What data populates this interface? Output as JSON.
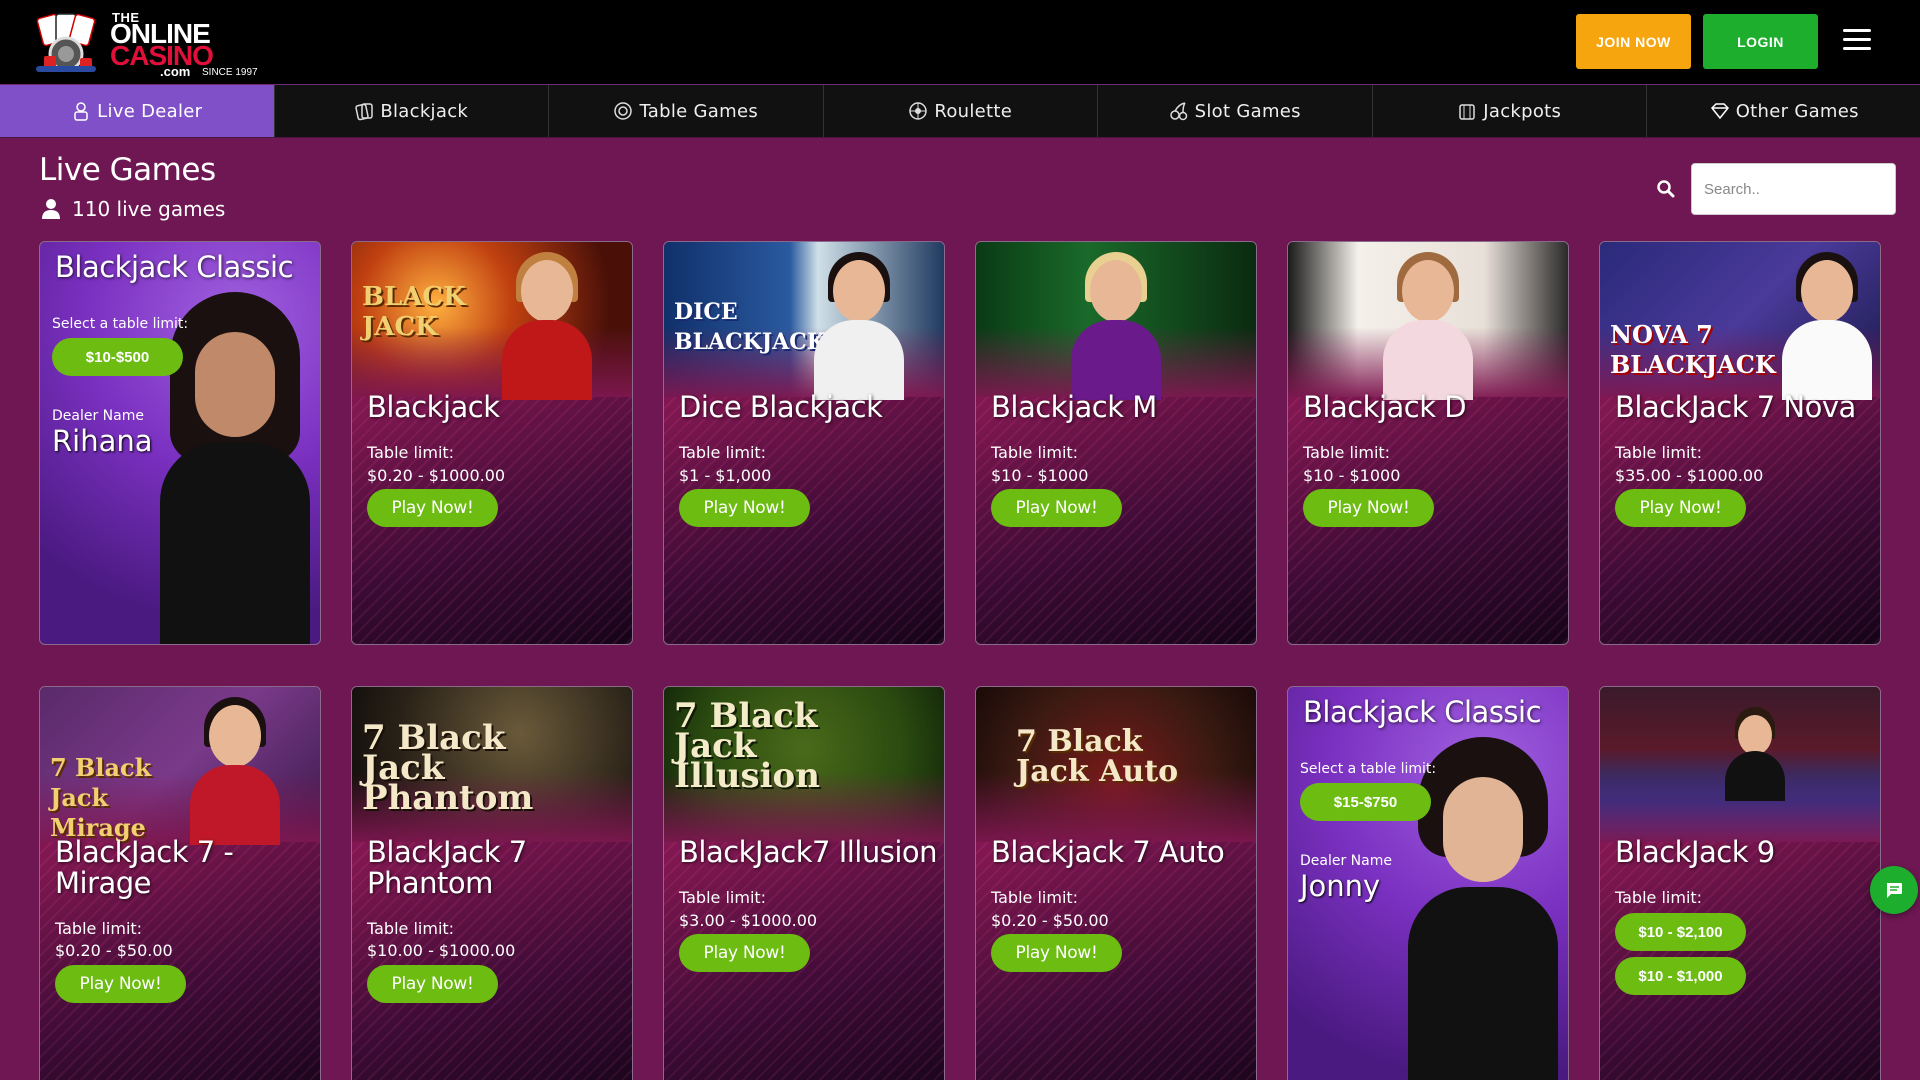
{
  "header": {
    "logo": {
      "line1": "THE",
      "line2": "ONLINE",
      "line3": "CASINO",
      "line4": ".com",
      "since": "SINCE 1997"
    },
    "join_label": "JOIN NOW",
    "login_label": "LOGIN"
  },
  "nav": {
    "items": [
      {
        "label": "Live Dealer",
        "icon": "dealer-icon",
        "active": true
      },
      {
        "label": "Blackjack",
        "icon": "cards-icon",
        "active": false
      },
      {
        "label": "Table Games",
        "icon": "chip-icon",
        "active": false
      },
      {
        "label": "Roulette",
        "icon": "roulette-icon",
        "active": false
      },
      {
        "label": "Slot Games",
        "icon": "cherry-icon",
        "active": false
      },
      {
        "label": "Jackpots",
        "icon": "jackpot-icon",
        "active": false
      },
      {
        "label": "Other Games",
        "icon": "diamond-icon",
        "active": false
      }
    ]
  },
  "main": {
    "title": "Live Games",
    "count": "110 live games",
    "search_placeholder": "Search.."
  },
  "cards": [
    {
      "type": "classic",
      "title": "Blackjack Classic",
      "select_label": "Select a table limit:",
      "limit": "$10-$500",
      "dealer_label": "Dealer Name",
      "dealer": "Rihana"
    },
    {
      "type": "game",
      "title": "Blackjack",
      "limit_label": "Table limit:",
      "limit": "$0.20 - $1000.00",
      "play": "Play Now!",
      "art": "BLACK JACK"
    },
    {
      "type": "game",
      "title": "Dice Blackjack",
      "limit_label": "Table limit:",
      "limit": "$1 - $1,000",
      "play": "Play Now!",
      "art": "DICE BLACKJACK"
    },
    {
      "type": "game",
      "title": "Blackjack M",
      "limit_label": "Table limit:",
      "limit": "$10 - $1000",
      "play": "Play Now!",
      "art": ""
    },
    {
      "type": "game",
      "title": "Blackjack D",
      "limit_label": "Table limit:",
      "limit": "$10 - $1000",
      "play": "Play Now!",
      "art": ""
    },
    {
      "type": "game",
      "title": "BlackJack 7 Nova",
      "limit_label": "Table limit:",
      "limit": "$35.00 - $1000.00",
      "play": "Play Now!",
      "art": "NOVA 7 BLACKJACK"
    },
    {
      "type": "game",
      "title": "BlackJack 7 - Mirage",
      "limit_label": "Table limit:",
      "limit": "$0.20 - $50.00",
      "play": "Play Now!",
      "art": "7 Black Jack Mirage"
    },
    {
      "type": "game",
      "title": "BlackJack 7 Phantom",
      "limit_label": "Table limit:",
      "limit": "$10.00 - $1000.00",
      "play": "Play Now!",
      "art": "7 Black Jack Phantom"
    },
    {
      "type": "game",
      "title": "BlackJack7 Illusion",
      "limit_label": "Table limit:",
      "limit": "$3.00 - $1000.00",
      "play": "Play Now!",
      "art": "7 Black Jack Illusion"
    },
    {
      "type": "game",
      "title": "Blackjack 7 Auto",
      "limit_label": "Table limit:",
      "limit": "$0.20 - $50.00",
      "play": "Play Now!",
      "art": "7 Black Jack Auto"
    },
    {
      "type": "classic",
      "title": "Blackjack Classic",
      "select_label": "Select a table limit:",
      "limit": "$15-$750",
      "dealer_label": "Dealer Name",
      "dealer": "Jonny"
    },
    {
      "type": "multi",
      "title": "BlackJack 9",
      "limit_label": "Table limit:",
      "limits": [
        "$10 - $2,100",
        "$10 - $1,000"
      ]
    }
  ],
  "colors": {
    "join": "#f7a50f",
    "login": "#1dae2d",
    "nav_active": "#8050c8",
    "page_bg": "#6e1752",
    "play": "#6cbc12"
  }
}
